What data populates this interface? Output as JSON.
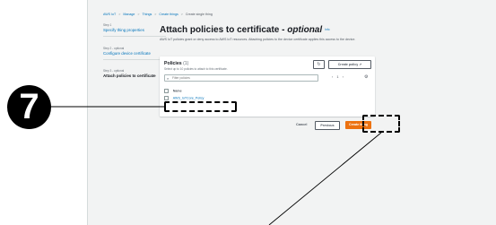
{
  "breadcrumb": [
    "AWS IoT",
    "Manage",
    "Things",
    "Create things",
    "Create single thing"
  ],
  "steps": [
    {
      "num": "Step 1",
      "title": "Specify thing properties"
    },
    {
      "num": "Step 2 - optional",
      "title": "Configure device certificate"
    },
    {
      "num": "Step 3 - optional",
      "title": "Attach policies to certificate"
    }
  ],
  "page": {
    "title": "Attach policies to certificate - ",
    "title_optional": "optional",
    "info": "Info",
    "description": "AWS IoT policies grant or deny access to AWS IoT resources. Attaching policies to the device certificate applies this access to the device."
  },
  "policies": {
    "title": "Policies",
    "count": "(1)",
    "subtitle": "Select up to 10 policies to attach to this certificate.",
    "create_policy_label": "Create policy",
    "filter_placeholder": "Filter policies",
    "pager_current": "1",
    "column_name": "Name",
    "rows": [
      {
        "name": "AWS_IoTCore_Policy"
      }
    ]
  },
  "footer": {
    "cancel": "Cancel",
    "previous": "Previous",
    "create": "Create thing"
  },
  "annotation": {
    "number": "7"
  },
  "colors": {
    "accent": "#ec7211",
    "link": "#0073bb"
  },
  "icons": [
    "refresh-icon",
    "external-link-icon",
    "search-icon",
    "chevron-left-icon",
    "chevron-right-icon",
    "gear-icon"
  ]
}
